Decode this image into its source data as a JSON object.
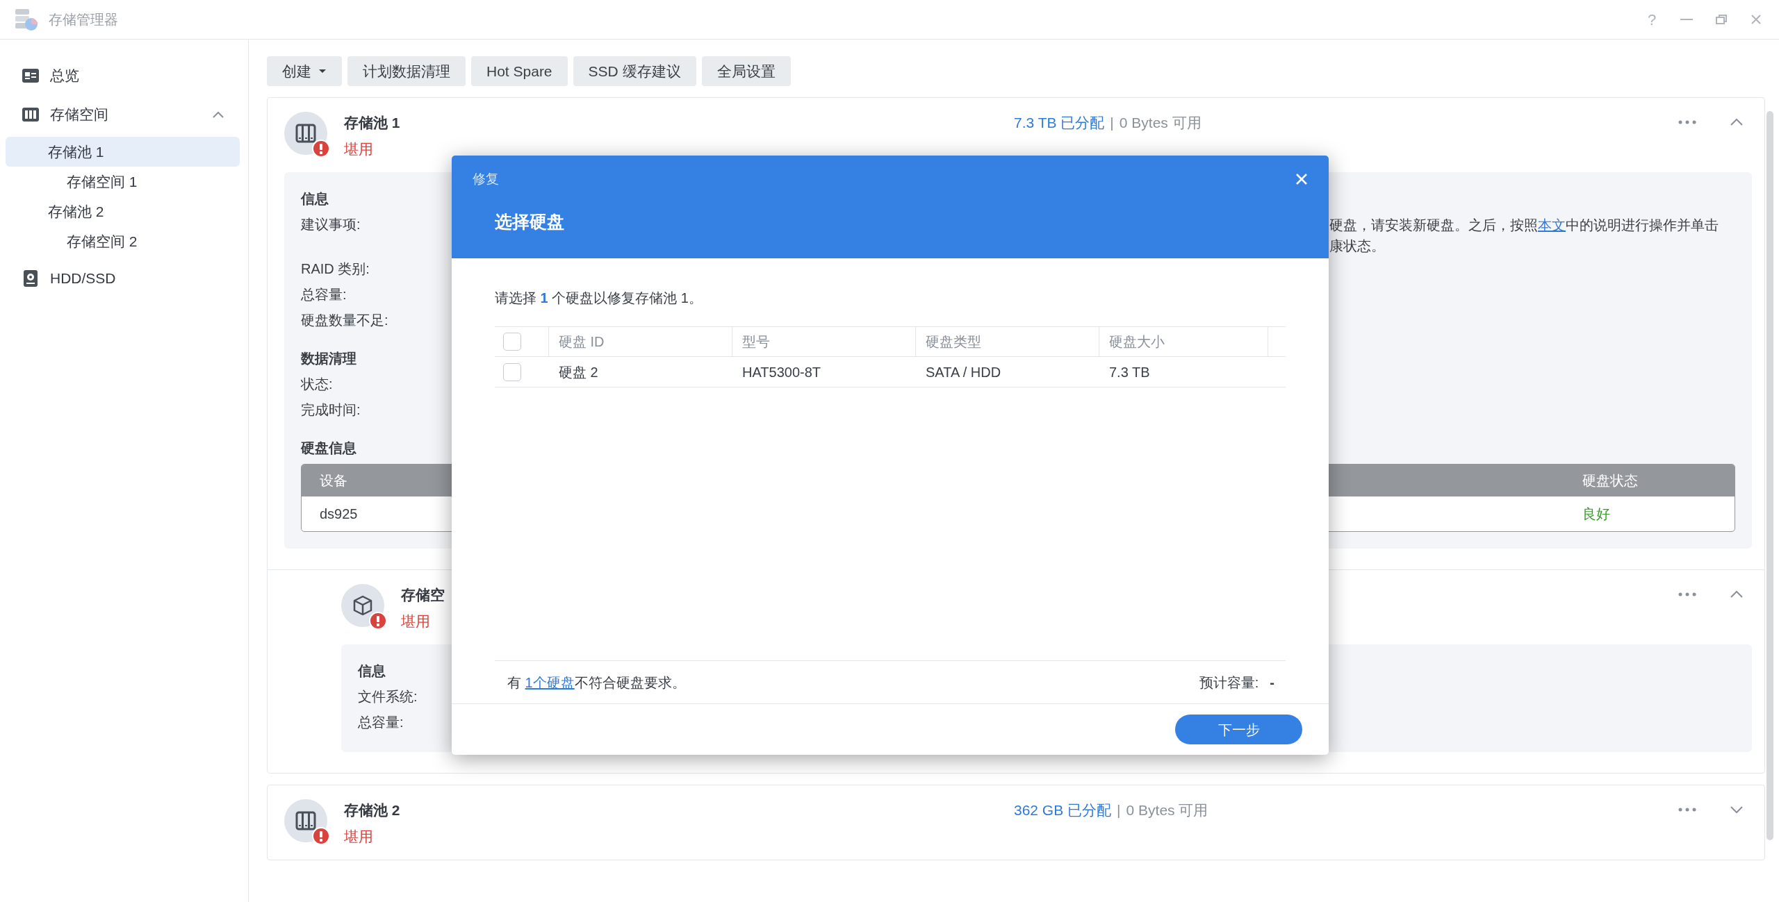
{
  "window": {
    "title": "存储管理器",
    "controls": [
      "?"
    ]
  },
  "sidebar": {
    "items": [
      {
        "label": "总览",
        "selected": false
      },
      {
        "label": "存储空间",
        "selected": false,
        "expanded": true,
        "children": [
          {
            "label": "存储池 1",
            "selected": true,
            "children": [
              {
                "label": "存储空间 1",
                "selected": false
              }
            ]
          },
          {
            "label": "存储池 2",
            "selected": false,
            "children": [
              {
                "label": "存储空间 2",
                "selected": false
              }
            ]
          }
        ]
      },
      {
        "label": "HDD/SSD",
        "selected": false
      }
    ]
  },
  "toolbar": [
    {
      "label": "创建",
      "dropdown": true
    },
    {
      "label": "计划数据清理",
      "dropdown": false
    },
    {
      "label": "Hot Spare",
      "dropdown": false
    },
    {
      "label": "SSD 缓存建议",
      "dropdown": false
    },
    {
      "label": "全局设置",
      "dropdown": false
    }
  ],
  "pools": [
    {
      "name": "存储池 1",
      "status": "堪用",
      "allocated": "7.3 TB 已分配",
      "separator": "|",
      "available": "0 Bytes 可用",
      "expanded": true,
      "info": [
        {
          "heading": "信息",
          "rows": [
            {
              "label": "建议事项:",
              "value": {
                "before": "硬盘，请安装新硬盘。之后，按照",
                "link": "本文",
                "after": "中的说明进行操作并单击",
                "line_2": "康状态。"
              }
            },
            {
              "label": "RAID 类别:"
            },
            {
              "label": "总容量:"
            },
            {
              "label": "硬盘数量不足:"
            }
          ]
        },
        {
          "heading": "数据清理",
          "rows": [
            {
              "label": "状态:"
            },
            {
              "label": "完成时间:"
            }
          ]
        },
        {
          "heading": "硬盘信息"
        }
      ],
      "disk_table": {
        "columns": [
          "设备",
          "硬盘状态"
        ],
        "rows": [
          [
            "ds925",
            "良好"
          ]
        ]
      },
      "volumes": [
        {
          "name": "存储空",
          "status": "堪用",
          "expanded": true,
          "info": [
            {
              "heading": "信息",
              "rows": [
                {
                  "label": "文件系统:"
                },
                {
                  "label": "总容量:"
                }
              ]
            }
          ]
        }
      ]
    },
    {
      "name": "存储池 2",
      "status": "堪用",
      "allocated": "362 GB 已分配",
      "separator": "|",
      "available": "0 Bytes 可用",
      "expanded": false
    }
  ],
  "dialog": {
    "title": "修复",
    "heading": "选择硬盘",
    "prompt": "请选择 **1** 个硬盘以修复存储池 1。",
    "table": {
      "header_checked": false,
      "columns": [
        "硬盘 ID",
        "型号",
        "硬盘类型",
        "硬盘大小"
      ],
      "rows": [
        {
          "checked": false,
          "cells": [
            "硬盘 2",
            "HAT5300-8T",
            "SATA / HDD",
            "7.3 TB"
          ]
        }
      ]
    },
    "note": {
      "before": "有 ",
      "link": "1个硬盘",
      "after": "不符合硬盘要求。"
    },
    "estimate_label": "预计容量:",
    "estimate_value": "-",
    "next_button": "下一步"
  }
}
